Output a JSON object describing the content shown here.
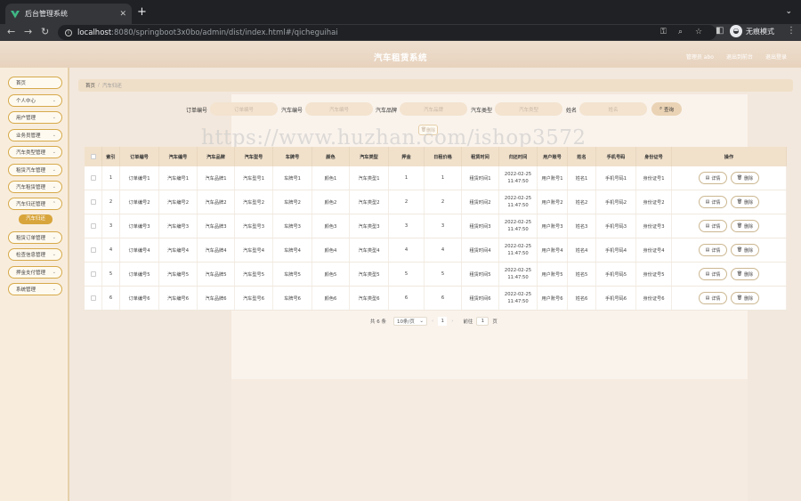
{
  "browser": {
    "tab_title": "后台管理系统",
    "url_host": "localhost",
    "url_rest": ":8080/springboot3x0bo/admin/dist/index.html#/qicheguihai",
    "incognito_label": "无痕模式"
  },
  "header": {
    "title": "汽车租赁系统",
    "admin_label": "管理员 abo",
    "front_label": "退出到前台",
    "logout_label": "退出登录"
  },
  "sidebar": {
    "items": [
      {
        "label": "首页",
        "chev": ""
      },
      {
        "label": "个人中心",
        "chev": "⌄"
      },
      {
        "label": "用户管理",
        "chev": "⌄"
      },
      {
        "label": "业务员管理",
        "chev": "⌄"
      },
      {
        "label": "汽车类型管理",
        "chev": "⌄"
      },
      {
        "label": "租赁汽车管理",
        "chev": "⌄"
      },
      {
        "label": "汽车租赁管理",
        "chev": "⌄"
      },
      {
        "label": "汽车归还管理",
        "chev": "⌃"
      },
      {
        "label": "租赁订单管理",
        "chev": "⌄"
      },
      {
        "label": "检查信息管理",
        "chev": "⌄"
      },
      {
        "label": "押金支付管理",
        "chev": "⌄"
      },
      {
        "label": "系统管理",
        "chev": "⌄"
      }
    ],
    "sub_active": "汽车归还"
  },
  "breadcrumb": {
    "home": "首页",
    "sep": "/",
    "current": "汽车归还"
  },
  "search": {
    "fields": [
      {
        "label": "订单编号",
        "placeholder": "订单编号"
      },
      {
        "label": "汽车编号",
        "placeholder": "汽车编号"
      },
      {
        "label": "汽车品牌",
        "placeholder": "汽车品牌"
      },
      {
        "label": "汽车类型",
        "placeholder": "汽车类型"
      },
      {
        "label": "姓名",
        "placeholder": "姓名"
      }
    ],
    "query_label": "查询",
    "delete_label": "删除"
  },
  "watermark": "https://www.huzhan.com/ishop3572",
  "table": {
    "headers": [
      "",
      "索引",
      "订单编号",
      "汽车编号",
      "汽车品牌",
      "汽车型号",
      "车牌号",
      "颜色",
      "汽车类型",
      "押金",
      "日租价格",
      "租赁时间",
      "归还时间",
      "用户账号",
      "姓名",
      "手机号码",
      "身份证号",
      "操作"
    ],
    "rows": [
      [
        "1",
        "订单编号1",
        "汽车编号1",
        "汽车品牌1",
        "汽车型号1",
        "车牌号1",
        "颜色1",
        "汽车类型1",
        "1",
        "1",
        "租赁时间1",
        "2022-02-25 11:47:50",
        "用户账号1",
        "姓名1",
        "手机号码1",
        "身份证号1"
      ],
      [
        "2",
        "订单编号2",
        "汽车编号2",
        "汽车品牌2",
        "汽车型号2",
        "车牌号2",
        "颜色2",
        "汽车类型2",
        "2",
        "2",
        "租赁时间2",
        "2022-02-25 11:47:50",
        "用户账号2",
        "姓名2",
        "手机号码2",
        "身份证号2"
      ],
      [
        "3",
        "订单编号3",
        "汽车编号3",
        "汽车品牌3",
        "汽车型号3",
        "车牌号3",
        "颜色3",
        "汽车类型3",
        "3",
        "3",
        "租赁时间3",
        "2022-02-25 11:47:50",
        "用户账号3",
        "姓名3",
        "手机号码3",
        "身份证号3"
      ],
      [
        "4",
        "订单编号4",
        "汽车编号4",
        "汽车品牌4",
        "汽车型号4",
        "车牌号4",
        "颜色4",
        "汽车类型4",
        "4",
        "4",
        "租赁时间4",
        "2022-02-25 11:47:50",
        "用户账号4",
        "姓名4",
        "手机号码4",
        "身份证号4"
      ],
      [
        "5",
        "订单编号5",
        "汽车编号5",
        "汽车品牌5",
        "汽车型号5",
        "车牌号5",
        "颜色5",
        "汽车类型5",
        "5",
        "5",
        "租赁时间5",
        "2022-02-25 11:47:50",
        "用户账号5",
        "姓名5",
        "手机号码5",
        "身份证号5"
      ],
      [
        "6",
        "订单编号6",
        "汽车编号6",
        "汽车品牌6",
        "汽车型号6",
        "车牌号6",
        "颜色6",
        "汽车类型6",
        "6",
        "6",
        "租赁时间6",
        "2022-02-25 11:47:50",
        "用户账号6",
        "姓名6",
        "手机号码6",
        "身份证号6"
      ]
    ],
    "detail_label": "详情",
    "delete_label": "删除"
  },
  "pager": {
    "total": "共 6 条",
    "page_size": "10条/页",
    "current_page": "1",
    "goto_label": "前往",
    "goto_value": "1",
    "page_unit": "页"
  },
  "colors": {
    "accent": "#d8a53c",
    "header_bg": "#e7d2bd",
    "table_head": "#f1e1cb"
  }
}
